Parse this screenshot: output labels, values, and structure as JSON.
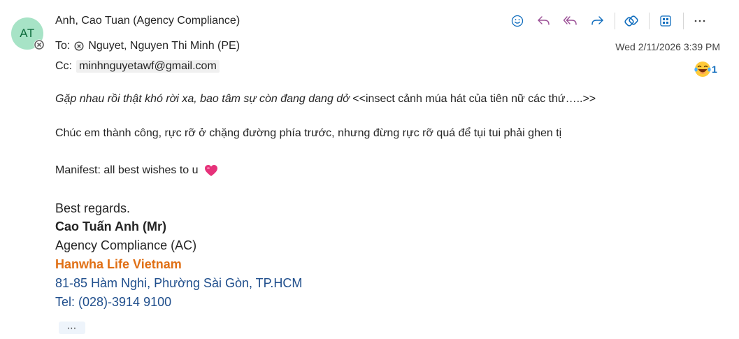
{
  "avatar": {
    "initials": "AT",
    "bg": "#a7e3c6",
    "text_color": "#0b6a3a",
    "status_icon": "blocked-presence-icon"
  },
  "header": {
    "sender": "Anh, Cao Tuan (Agency Compliance)",
    "to_label": "To:",
    "to_recipient": "Nguyet, Nguyen Thi Minh (PE)",
    "cc_label": "Cc:",
    "cc_recipient": "minhnguyetawf@gmail.com",
    "timestamp": "Wed 2/11/2026 3:39 PM"
  },
  "toolbar": {
    "icons": [
      "emoji-icon",
      "reply-icon",
      "reply-all-icon",
      "forward-icon",
      "loop-icon",
      "apps-icon",
      "more-icon"
    ],
    "accent": "#0f6cbd"
  },
  "reaction": {
    "icon": "laughing-emoji-icon",
    "count": "1"
  },
  "body": {
    "line1_italic": "Gặp nhau rồi thật khó rời xa, bao tâm sự còn đang dang dở",
    "line1_suffix": " <<insect cảnh múa hát của tiên nữ các thứ…..>>",
    "line2": "Chúc em thành công, rực rỡ ở chặng đường phía trước, nhưng đừng rực rỡ quá để tụi tui phải ghen tị",
    "line3": "Manifest: all best wishes to u",
    "line3_icon": "heart-icon"
  },
  "signature": {
    "closing": "Best regards.",
    "name": "Cao Tuấn Anh (Mr)",
    "department": "Agency Compliance (AC)",
    "company": "Hanwha Life Vietnam",
    "address": "81-85 Hàm Nghi, Phường Sài Gòn, TP.HCM",
    "phone": "Tel: (028)-3914 9100",
    "company_color": "#e06f14",
    "contact_color": "#1f4e8c"
  },
  "more_button": {
    "label": "⋯"
  }
}
